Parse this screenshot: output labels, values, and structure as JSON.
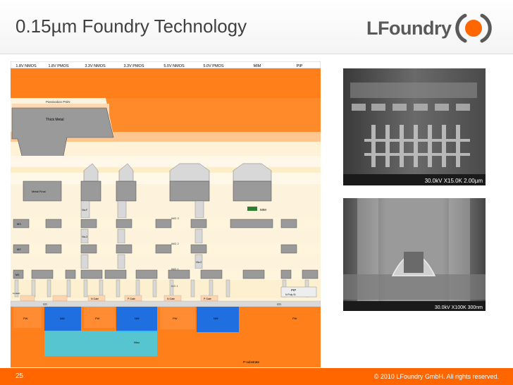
{
  "slide": {
    "title": "0.15µm Foundry Technology",
    "logo_text": "LFoundry",
    "page_number": "25",
    "copyright": "© 2010 LFoundry GmbH. All rights reserved."
  },
  "diagram": {
    "columns": [
      "1.8V NMOS",
      "1.8V PMOS",
      "3.3V NMOS",
      "3.3V PMOS",
      "5.0V NMOS",
      "5.0V PMOS",
      "MIM",
      "PIP"
    ],
    "layers": {
      "passivation_top": "Passivation PSiN",
      "passivation_bottom": "Passivation PSiN",
      "ild_top": "IMD",
      "thick_metal": "Thick Metal",
      "via_t": "Via-T",
      "metal_final": "Metal Final",
      "via_f": "Via-F",
      "imd3": "IMD 3",
      "imd2": "IMD 2",
      "imd1": "IMD 1",
      "ild1": "ILD 1",
      "via3": "Via-3",
      "via2": "Via-2",
      "via1": "Via-1",
      "contact": "Contact",
      "m3": "M3",
      "m2": "M2",
      "m1": "M1",
      "mim": "MIM",
      "sti": "STI",
      "pip": "PIP",
      "npoly": "N Poly Si",
      "p_substrate": "P-substrate",
      "nwell_deep": "Nlso",
      "pw": "PW",
      "nw": "NW",
      "n_gate": "N Gate",
      "p_gate": "P Gate"
    }
  },
  "sem_images": {
    "top_scale": "30.0kV X15.0K 2.00µm",
    "bottom_scale": "30.0kV X100K 300nm"
  },
  "colors": {
    "accent": "#ff6600",
    "title_text": "#404040",
    "logo_text": "#595959"
  }
}
